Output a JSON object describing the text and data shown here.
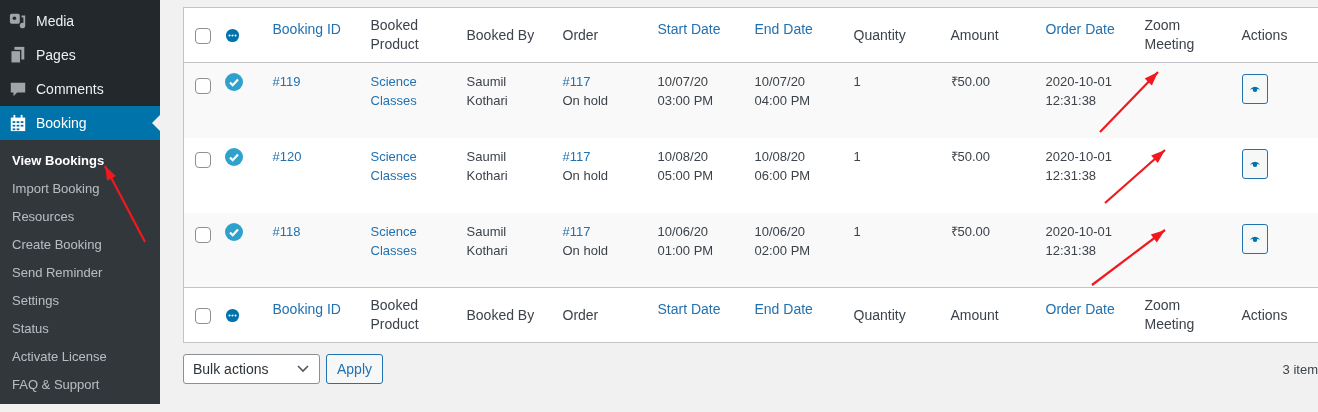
{
  "sidebar": {
    "items": [
      {
        "label": "Media",
        "selected": false
      },
      {
        "label": "Pages",
        "selected": false
      },
      {
        "label": "Comments",
        "selected": false
      },
      {
        "label": "Booking",
        "selected": true
      }
    ],
    "submenu": [
      {
        "label": "View Bookings",
        "selected": true
      },
      {
        "label": "Import Booking",
        "selected": false
      },
      {
        "label": "Resources",
        "selected": false
      },
      {
        "label": "Create Booking",
        "selected": false
      },
      {
        "label": "Send Reminder",
        "selected": false
      },
      {
        "label": "Settings",
        "selected": false
      },
      {
        "label": "Status",
        "selected": false
      },
      {
        "label": "Activate License",
        "selected": false
      },
      {
        "label": "FAQ & Support",
        "selected": false
      }
    ]
  },
  "table": {
    "header": {
      "checked": false,
      "columns": [
        {
          "label": "Booking ID",
          "sortable": true
        },
        {
          "label": "Booked Product",
          "sortable": false
        },
        {
          "label": "Booked By",
          "sortable": false
        },
        {
          "label": "Order",
          "sortable": false
        },
        {
          "label": "Start Date",
          "sortable": true
        },
        {
          "label": "End Date",
          "sortable": true
        },
        {
          "label": "Quantity",
          "sortable": false
        },
        {
          "label": "Amount",
          "sortable": false
        },
        {
          "label": "Order Date",
          "sortable": true
        },
        {
          "label": "Zoom Meeting",
          "sortable": false
        },
        {
          "label": "Actions",
          "sortable": false
        }
      ]
    },
    "rows": [
      {
        "checked": false,
        "confirmed": true,
        "booking_id": "#119",
        "product": [
          "Science",
          "Classes"
        ],
        "booked_by": [
          "Saumil",
          "Kothari"
        ],
        "order": "#117",
        "order_status": "On hold",
        "start": [
          "10/07/20",
          "03:00 PM"
        ],
        "end": [
          "10/07/20",
          "04:00 PM"
        ],
        "quantity": "1",
        "amount": "₹50.00",
        "order_date": [
          "2020-10-01",
          "12:31:38"
        ]
      },
      {
        "checked": false,
        "confirmed": true,
        "booking_id": "#120",
        "product": [
          "Science",
          "Classes"
        ],
        "booked_by": [
          "Saumil",
          "Kothari"
        ],
        "order": "#117",
        "order_status": "On hold",
        "start": [
          "10/08/20",
          "05:00 PM"
        ],
        "end": [
          "10/08/20",
          "06:00 PM"
        ],
        "quantity": "1",
        "amount": "₹50.00",
        "order_date": [
          "2020-10-01",
          "12:31:38"
        ]
      },
      {
        "checked": false,
        "confirmed": true,
        "booking_id": "#118",
        "product": [
          "Science",
          "Classes"
        ],
        "booked_by": [
          "Saumil",
          "Kothari"
        ],
        "order": "#117",
        "order_status": "On hold",
        "start": [
          "10/06/20",
          "01:00 PM"
        ],
        "end": [
          "10/06/20",
          "02:00 PM"
        ],
        "quantity": "1",
        "amount": "₹50.00",
        "order_date": [
          "2020-10-01",
          "12:31:38"
        ]
      }
    ],
    "footer": {
      "checked": false,
      "columns": [
        {
          "label": "Booking ID",
          "sortable": true
        },
        {
          "label": "Booked Product",
          "sortable": false
        },
        {
          "label": "Booked By",
          "sortable": false
        },
        {
          "label": "Order",
          "sortable": false
        },
        {
          "label": "Start Date",
          "sortable": true
        },
        {
          "label": "End Date",
          "sortable": true
        },
        {
          "label": "Quantity",
          "sortable": false
        },
        {
          "label": "Amount",
          "sortable": false
        },
        {
          "label": "Order Date",
          "sortable": true
        },
        {
          "label": "Zoom Meeting",
          "sortable": false
        },
        {
          "label": "Actions",
          "sortable": false
        }
      ]
    }
  },
  "bulk_actions": {
    "value": "Bulk actions",
    "button": "Apply"
  },
  "item_count": "3 item"
}
